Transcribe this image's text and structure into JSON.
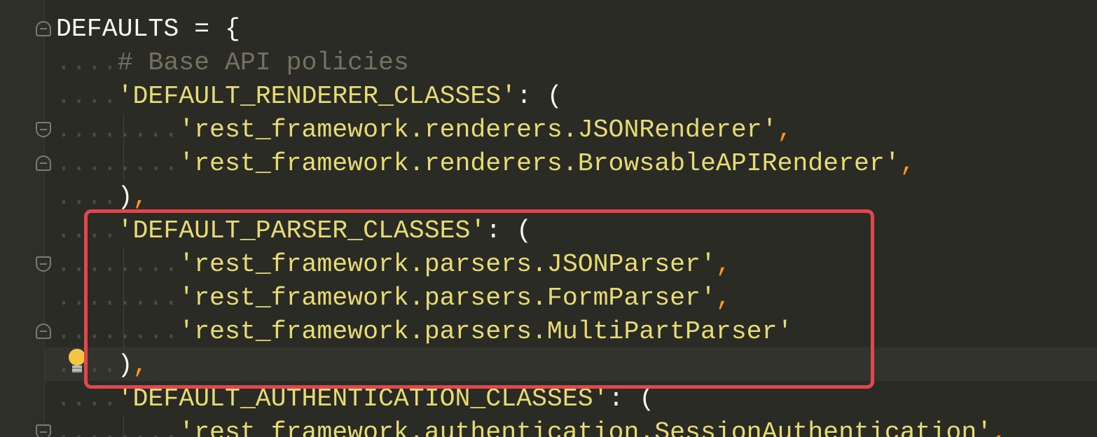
{
  "editor": {
    "lines": [
      {
        "indent": "",
        "parts": [
          {
            "t": "DEFAULTS = {",
            "c": "ident"
          }
        ]
      },
      {
        "indent": "....",
        "parts": [
          {
            "t": "# Base API policies",
            "c": "comment"
          }
        ]
      },
      {
        "indent": "....",
        "parts": [
          {
            "t": "'DEFAULT_RENDERER_CLASSES'",
            "c": "str"
          },
          {
            "t": ": (",
            "c": "punc"
          }
        ]
      },
      {
        "indent": "........",
        "parts": [
          {
            "t": "'rest_framework.renderers.JSONRenderer'",
            "c": "str"
          },
          {
            "t": ",",
            "c": "comma"
          }
        ]
      },
      {
        "indent": "........",
        "parts": [
          {
            "t": "'rest_framework.renderers.BrowsableAPIRenderer'",
            "c": "str"
          },
          {
            "t": ",",
            "c": "comma"
          }
        ]
      },
      {
        "indent": "....",
        "parts": [
          {
            "t": ")",
            "c": "punc"
          },
          {
            "t": ",",
            "c": "comma"
          }
        ]
      },
      {
        "indent": "....",
        "parts": [
          {
            "t": "'DEFAULT_PARSER_CLASSES'",
            "c": "str"
          },
          {
            "t": ": (",
            "c": "punc"
          }
        ]
      },
      {
        "indent": "........",
        "parts": [
          {
            "t": "'rest_framework.parsers.JSONParser'",
            "c": "str"
          },
          {
            "t": ",",
            "c": "comma"
          }
        ]
      },
      {
        "indent": "........",
        "parts": [
          {
            "t": "'rest_framework.parsers.FormParser'",
            "c": "str"
          },
          {
            "t": ",",
            "c": "comma"
          }
        ]
      },
      {
        "indent": "........",
        "parts": [
          {
            "t": "'rest_framework.parsers.MultiPartParser'",
            "c": "str"
          }
        ]
      },
      {
        "indent": "....",
        "parts": [
          {
            "t": ")",
            "c": "punc"
          },
          {
            "t": ",",
            "c": "comma"
          }
        ]
      },
      {
        "indent": "....",
        "parts": [
          {
            "t": "'DEFAULT_AUTHENTICATION_CLASSES'",
            "c": "str"
          },
          {
            "t": ": (",
            "c": "punc"
          }
        ]
      },
      {
        "indent": "........",
        "parts": [
          {
            "t": "'rest_framework.authentication.SessionAuthentication'",
            "c": "str"
          },
          {
            "t": ",",
            "c": "comma"
          }
        ]
      }
    ]
  },
  "colors": {
    "background": "#2b2b26",
    "string": "#e6db74",
    "comment": "#75715e",
    "highlight_box": "#e0484e"
  },
  "icons": {
    "bulb": "lightbulb-icon",
    "fold": "fold-marker-icon"
  }
}
